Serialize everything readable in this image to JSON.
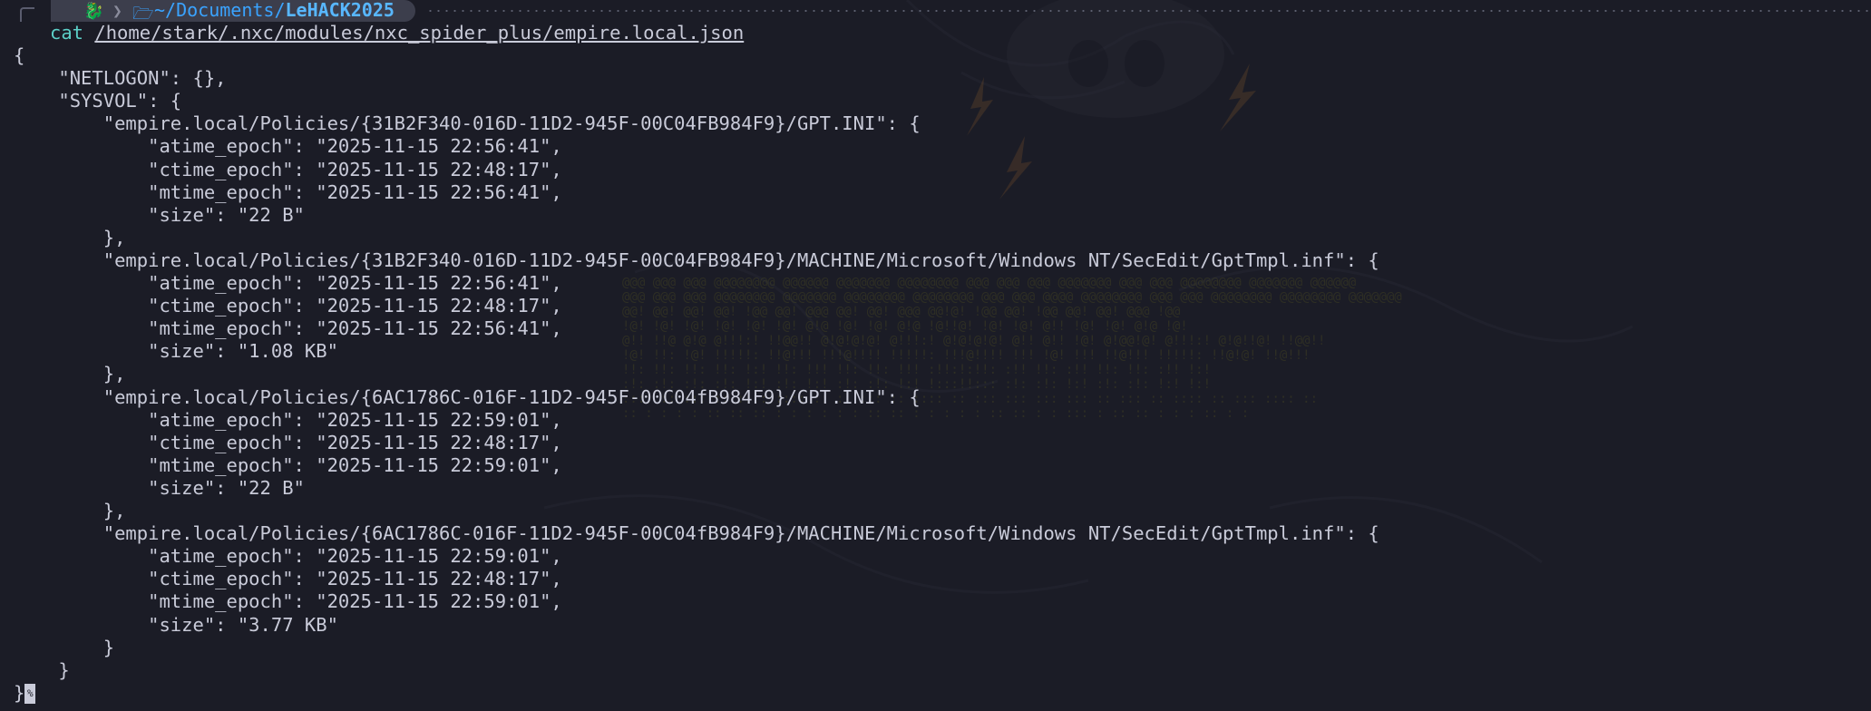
{
  "prompt": {
    "home": "~/Documents/",
    "dir": "LeHACK2025",
    "command": "cat",
    "argument": "/home/stark/.nxc/modules/nxc_spider_plus/empire.local.json"
  },
  "output_lines": [
    "{",
    "    \"NETLOGON\": {},",
    "    \"SYSVOL\": {",
    "        \"empire.local/Policies/{31B2F340-016D-11D2-945F-00C04FB984F9}/GPT.INI\": {",
    "            \"atime_epoch\": \"2025-11-15 22:56:41\",",
    "            \"ctime_epoch\": \"2025-11-15 22:48:17\",",
    "            \"mtime_epoch\": \"2025-11-15 22:56:41\",",
    "            \"size\": \"22 B\"",
    "        },",
    "        \"empire.local/Policies/{31B2F340-016D-11D2-945F-00C04FB984F9}/MACHINE/Microsoft/Windows NT/SecEdit/GptTmpl.inf\": {",
    "            \"atime_epoch\": \"2025-11-15 22:56:41\",",
    "            \"ctime_epoch\": \"2025-11-15 22:48:17\",",
    "            \"mtime_epoch\": \"2025-11-15 22:56:41\",",
    "            \"size\": \"1.08 KB\"",
    "        },",
    "        \"empire.local/Policies/{6AC1786C-016F-11D2-945F-00C04fB984F9}/GPT.INI\": {",
    "            \"atime_epoch\": \"2025-11-15 22:59:01\",",
    "            \"ctime_epoch\": \"2025-11-15 22:48:17\",",
    "            \"mtime_epoch\": \"2025-11-15 22:59:01\",",
    "            \"size\": \"22 B\"",
    "        },",
    "        \"empire.local/Policies/{6AC1786C-016F-11D2-945F-00C04fB984F9}/MACHINE/Microsoft/Windows NT/SecEdit/GptTmpl.inf\": {",
    "            \"atime_epoch\": \"2025-11-15 22:59:01\",",
    "            \"ctime_epoch\": \"2025-11-15 22:48:17\",",
    "            \"mtime_epoch\": \"2025-11-15 22:59:01\",",
    "            \"size\": \"3.77 KB\"",
    "        }",
    "    }",
    "}"
  ],
  "cursor_glyph": "%",
  "icons": {
    "distro": "kali-dragon-icon",
    "folder": "folder-open-icon"
  },
  "colors": {
    "background": "#1b1c26",
    "text": "#c9cbd9",
    "path": "#3aa3ff",
    "command": "#5cd0c8",
    "prompt_segment": "#3c3e4c"
  }
}
